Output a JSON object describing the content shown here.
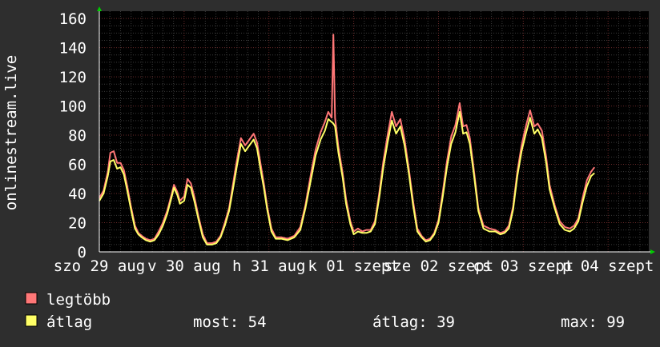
{
  "chart_data": {
    "type": "line",
    "ylabel": "onlinestream.live",
    "ylim": [
      0,
      165
    ],
    "yticks": [
      0,
      20,
      40,
      60,
      80,
      100,
      120,
      140,
      160
    ],
    "xlim": [
      0,
      6.48
    ],
    "x_tick_labels": [
      {
        "x": 0,
        "label": "szo 29 aug"
      },
      {
        "x": 1,
        "label": "v 30 aug"
      },
      {
        "x": 2,
        "label": "h 31 aug"
      },
      {
        "x": 3,
        "label": "k 01 szept"
      },
      {
        "x": 4,
        "label": "sze 02 szept"
      },
      {
        "x": 5,
        "label": "cs 03 szept"
      },
      {
        "x": 6,
        "label": "p 04 szept"
      }
    ],
    "grid": true,
    "series": [
      {
        "name": "legtöbb",
        "color": "#ff7777",
        "points": [
          [
            0.0,
            37
          ],
          [
            0.05,
            42
          ],
          [
            0.1,
            55
          ],
          [
            0.13,
            68
          ],
          [
            0.17,
            69
          ],
          [
            0.21,
            61
          ],
          [
            0.25,
            61
          ],
          [
            0.29,
            56
          ],
          [
            0.33,
            45
          ],
          [
            0.37,
            32
          ],
          [
            0.42,
            18
          ],
          [
            0.46,
            13
          ],
          [
            0.5,
            11
          ],
          [
            0.55,
            9
          ],
          [
            0.6,
            8
          ],
          [
            0.65,
            9
          ],
          [
            0.7,
            14
          ],
          [
            0.75,
            20
          ],
          [
            0.8,
            28
          ],
          [
            0.85,
            39
          ],
          [
            0.88,
            46
          ],
          [
            0.92,
            41
          ],
          [
            0.95,
            35
          ],
          [
            1.0,
            38
          ],
          [
            1.04,
            50
          ],
          [
            1.08,
            47
          ],
          [
            1.12,
            38
          ],
          [
            1.17,
            24
          ],
          [
            1.22,
            12
          ],
          [
            1.27,
            6
          ],
          [
            1.33,
            6
          ],
          [
            1.38,
            7
          ],
          [
            1.43,
            11
          ],
          [
            1.48,
            20
          ],
          [
            1.53,
            30
          ],
          [
            1.57,
            44
          ],
          [
            1.62,
            62
          ],
          [
            1.67,
            78
          ],
          [
            1.72,
            73
          ],
          [
            1.77,
            77
          ],
          [
            1.82,
            81
          ],
          [
            1.86,
            75
          ],
          [
            1.9,
            61
          ],
          [
            1.94,
            47
          ],
          [
            1.98,
            31
          ],
          [
            2.03,
            16
          ],
          [
            2.08,
            10
          ],
          [
            2.15,
            10
          ],
          [
            2.22,
            9
          ],
          [
            2.3,
            11
          ],
          [
            2.37,
            17
          ],
          [
            2.43,
            32
          ],
          [
            2.5,
            55
          ],
          [
            2.55,
            70
          ],
          [
            2.61,
            82
          ],
          [
            2.66,
            89
          ],
          [
            2.7,
            96
          ],
          [
            2.74,
            92
          ],
          [
            2.76,
            149
          ],
          [
            2.78,
            92
          ],
          [
            2.82,
            72
          ],
          [
            2.87,
            54
          ],
          [
            2.91,
            36
          ],
          [
            2.96,
            21
          ],
          [
            3.0,
            14
          ],
          [
            3.05,
            16
          ],
          [
            3.1,
            14
          ],
          [
            3.15,
            15
          ],
          [
            3.2,
            15
          ],
          [
            3.25,
            21
          ],
          [
            3.3,
            40
          ],
          [
            3.35,
            62
          ],
          [
            3.4,
            80
          ],
          [
            3.45,
            96
          ],
          [
            3.5,
            86
          ],
          [
            3.55,
            91
          ],
          [
            3.6,
            77
          ],
          [
            3.65,
            57
          ],
          [
            3.7,
            35
          ],
          [
            3.75,
            16
          ],
          [
            3.8,
            11
          ],
          [
            3.85,
            8
          ],
          [
            3.9,
            9
          ],
          [
            3.95,
            13
          ],
          [
            4.0,
            22
          ],
          [
            4.05,
            41
          ],
          [
            4.1,
            62
          ],
          [
            4.15,
            79
          ],
          [
            4.2,
            87
          ],
          [
            4.25,
            102
          ],
          [
            4.29,
            86
          ],
          [
            4.33,
            87
          ],
          [
            4.37,
            78
          ],
          [
            4.42,
            55
          ],
          [
            4.47,
            30
          ],
          [
            4.53,
            18
          ],
          [
            4.6,
            16
          ],
          [
            4.67,
            15
          ],
          [
            4.73,
            13
          ],
          [
            4.78,
            14
          ],
          [
            4.83,
            18
          ],
          [
            4.88,
            31
          ],
          [
            4.93,
            55
          ],
          [
            4.98,
            73
          ],
          [
            5.03,
            86
          ],
          [
            5.08,
            97
          ],
          [
            5.13,
            86
          ],
          [
            5.17,
            88
          ],
          [
            5.22,
            83
          ],
          [
            5.27,
            65
          ],
          [
            5.31,
            46
          ],
          [
            5.37,
            32
          ],
          [
            5.43,
            21
          ],
          [
            5.49,
            17
          ],
          [
            5.55,
            16
          ],
          [
            5.6,
            18
          ],
          [
            5.65,
            23
          ],
          [
            5.7,
            37
          ],
          [
            5.75,
            49
          ],
          [
            5.8,
            55
          ],
          [
            5.84,
            58
          ]
        ]
      },
      {
        "name": "átlag",
        "color": "#ffff66",
        "points": [
          [
            0.0,
            35
          ],
          [
            0.05,
            40
          ],
          [
            0.1,
            52
          ],
          [
            0.13,
            62
          ],
          [
            0.17,
            63
          ],
          [
            0.21,
            57
          ],
          [
            0.25,
            58
          ],
          [
            0.29,
            53
          ],
          [
            0.33,
            42
          ],
          [
            0.37,
            30
          ],
          [
            0.42,
            16
          ],
          [
            0.46,
            12
          ],
          [
            0.5,
            10
          ],
          [
            0.55,
            8
          ],
          [
            0.6,
            7
          ],
          [
            0.65,
            8
          ],
          [
            0.7,
            12
          ],
          [
            0.75,
            18
          ],
          [
            0.8,
            26
          ],
          [
            0.85,
            37
          ],
          [
            0.88,
            44
          ],
          [
            0.92,
            39
          ],
          [
            0.95,
            33
          ],
          [
            1.0,
            35
          ],
          [
            1.04,
            46
          ],
          [
            1.08,
            44
          ],
          [
            1.12,
            35
          ],
          [
            1.17,
            22
          ],
          [
            1.22,
            10
          ],
          [
            1.27,
            5
          ],
          [
            1.33,
            5
          ],
          [
            1.38,
            6
          ],
          [
            1.43,
            10
          ],
          [
            1.48,
            18
          ],
          [
            1.53,
            28
          ],
          [
            1.57,
            41
          ],
          [
            1.62,
            58
          ],
          [
            1.67,
            74
          ],
          [
            1.72,
            69
          ],
          [
            1.77,
            73
          ],
          [
            1.82,
            77
          ],
          [
            1.86,
            71
          ],
          [
            1.9,
            57
          ],
          [
            1.94,
            44
          ],
          [
            1.98,
            29
          ],
          [
            2.03,
            14
          ],
          [
            2.08,
            9
          ],
          [
            2.15,
            9
          ],
          [
            2.22,
            8
          ],
          [
            2.3,
            10
          ],
          [
            2.37,
            15
          ],
          [
            2.43,
            30
          ],
          [
            2.5,
            51
          ],
          [
            2.55,
            66
          ],
          [
            2.61,
            77
          ],
          [
            2.66,
            83
          ],
          [
            2.7,
            91
          ],
          [
            2.74,
            89
          ],
          [
            2.76,
            88
          ],
          [
            2.78,
            86
          ],
          [
            2.82,
            68
          ],
          [
            2.87,
            51
          ],
          [
            2.91,
            33
          ],
          [
            2.96,
            19
          ],
          [
            3.0,
            12
          ],
          [
            3.05,
            14
          ],
          [
            3.1,
            13
          ],
          [
            3.15,
            13
          ],
          [
            3.2,
            14
          ],
          [
            3.25,
            19
          ],
          [
            3.3,
            37
          ],
          [
            3.35,
            58
          ],
          [
            3.4,
            75
          ],
          [
            3.45,
            90
          ],
          [
            3.5,
            81
          ],
          [
            3.55,
            86
          ],
          [
            3.6,
            73
          ],
          [
            3.65,
            54
          ],
          [
            3.7,
            32
          ],
          [
            3.75,
            14
          ],
          [
            3.8,
            10
          ],
          [
            3.85,
            7
          ],
          [
            3.9,
            8
          ],
          [
            3.95,
            12
          ],
          [
            4.0,
            20
          ],
          [
            4.05,
            38
          ],
          [
            4.1,
            58
          ],
          [
            4.15,
            74
          ],
          [
            4.2,
            82
          ],
          [
            4.25,
            96
          ],
          [
            4.29,
            81
          ],
          [
            4.33,
            82
          ],
          [
            4.37,
            74
          ],
          [
            4.42,
            52
          ],
          [
            4.47,
            28
          ],
          [
            4.53,
            16
          ],
          [
            4.6,
            14
          ],
          [
            4.67,
            14
          ],
          [
            4.73,
            12
          ],
          [
            4.78,
            13
          ],
          [
            4.83,
            16
          ],
          [
            4.88,
            29
          ],
          [
            4.93,
            52
          ],
          [
            4.98,
            69
          ],
          [
            5.03,
            81
          ],
          [
            5.08,
            92
          ],
          [
            5.13,
            81
          ],
          [
            5.17,
            84
          ],
          [
            5.22,
            78
          ],
          [
            5.27,
            61
          ],
          [
            5.31,
            43
          ],
          [
            5.37,
            30
          ],
          [
            5.43,
            19
          ],
          [
            5.49,
            15
          ],
          [
            5.55,
            14
          ],
          [
            5.6,
            16
          ],
          [
            5.65,
            21
          ],
          [
            5.7,
            34
          ],
          [
            5.75,
            45
          ],
          [
            5.8,
            52
          ],
          [
            5.84,
            54
          ]
        ]
      }
    ]
  },
  "legend": [
    {
      "label": "legtöbb",
      "color": "#ff7777"
    },
    {
      "label": "átlag",
      "color": "#ffff66"
    }
  ],
  "stats": {
    "now": "most: 54",
    "avg": "átlag: 39",
    "max": "max: 99"
  }
}
